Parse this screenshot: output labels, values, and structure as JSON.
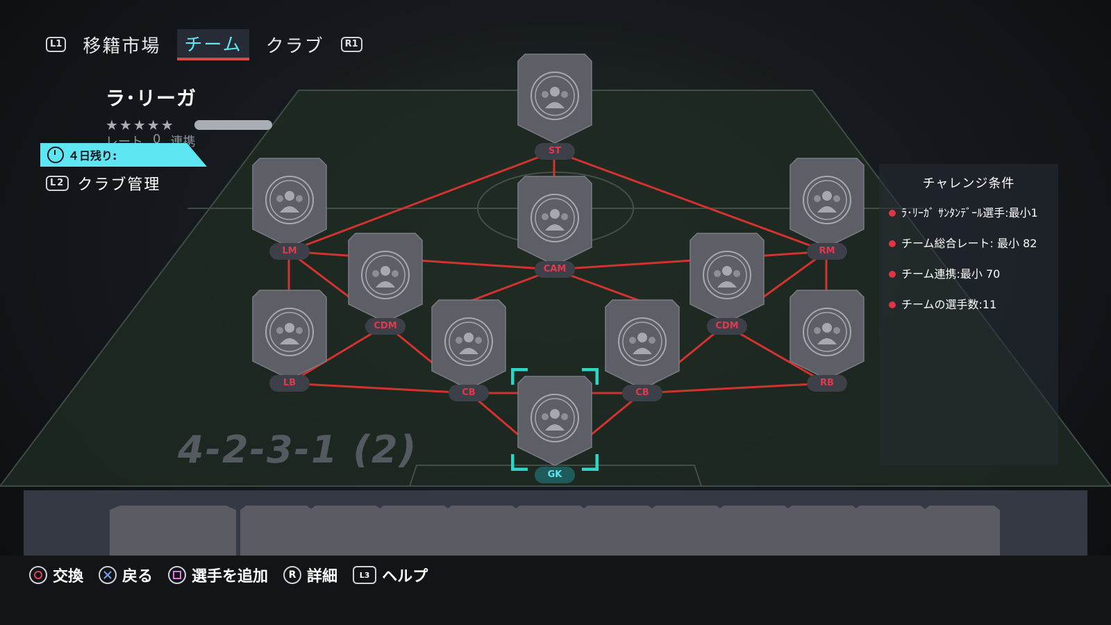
{
  "header": {
    "tab_prev_button": "L1",
    "tab_next_button": "R1",
    "tabs": [
      {
        "label": "移籍市場"
      },
      {
        "label": "チーム"
      },
      {
        "label": "クラブ"
      }
    ],
    "active_tab": "チーム"
  },
  "squad": {
    "name": "ラ･リーガ",
    "rating_label": "レート",
    "rating_value": "0",
    "chemistry_label": "連携",
    "stars": "★★★★★"
  },
  "timer": {
    "label": "４日残り:"
  },
  "club_management": {
    "button": "L2",
    "label": "クラブ管理"
  },
  "formation": {
    "label": "4-2-3-1 (2)"
  },
  "positions": [
    {
      "pos": "ST"
    },
    {
      "pos": "LM"
    },
    {
      "pos": "CAM"
    },
    {
      "pos": "RM"
    },
    {
      "pos": "CDM"
    },
    {
      "pos": "CDM"
    },
    {
      "pos": "LB"
    },
    {
      "pos": "CB"
    },
    {
      "pos": "CB"
    },
    {
      "pos": "RB"
    },
    {
      "pos": "GK"
    }
  ],
  "selected_position": "GK",
  "challenge": {
    "title": "チャレンジ条件",
    "requirements": [
      "ﾗ･ﾘｰｶﾞ ｻﾝﾀﾝﾃﾞｰﾙ選手:最小1",
      "チーム総合レート: 最小 82",
      "チーム連携:最小 70",
      "チームの選手数:11"
    ]
  },
  "controls": [
    {
      "icon": "circle-button-icon",
      "label": "交換"
    },
    {
      "icon": "cross-button-icon",
      "label": "戻る"
    },
    {
      "icon": "square-button-icon",
      "label": "選手を追加"
    },
    {
      "icon": "right-stick-icon",
      "label": "詳細",
      "glyph": "R"
    },
    {
      "icon": "l3-stick-icon",
      "label": "ヘルプ",
      "glyph": "L3"
    }
  ],
  "colors": {
    "accent": "#5de6f2",
    "link_line": "#d3332f",
    "position_text": "#e13a4c",
    "card": "#5e5e66",
    "challenge_dot": "#e23446"
  }
}
